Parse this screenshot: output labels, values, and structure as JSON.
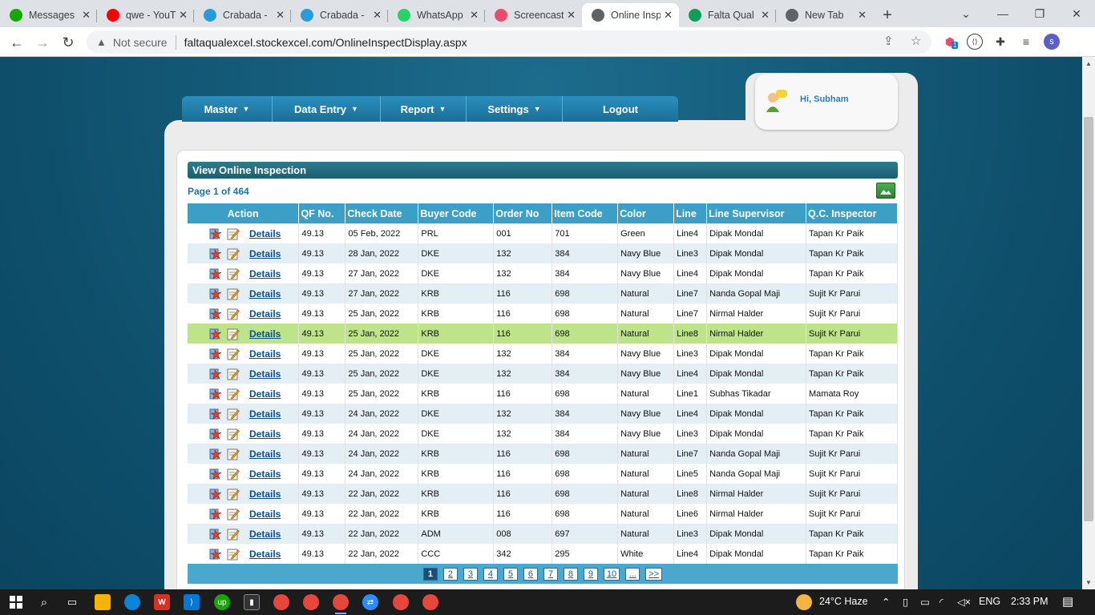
{
  "browser": {
    "tabs": [
      {
        "title": "Messages",
        "icon": "upwork-icon",
        "color": "#14a800"
      },
      {
        "title": "qwe - YouT",
        "icon": "youtube-icon",
        "color": "#ff0000"
      },
      {
        "title": "Crabada -",
        "icon": "crabada-icon",
        "color": "#2a9bd6"
      },
      {
        "title": "Crabada -",
        "icon": "crabada-icon",
        "color": "#2a9bd6"
      },
      {
        "title": "WhatsApp",
        "icon": "whatsapp-icon",
        "color": "#25d366"
      },
      {
        "title": "Screencast",
        "icon": "screencast-icon",
        "color": "#e94c6f"
      },
      {
        "title": "Online Insp",
        "icon": "globe-icon",
        "color": "#5f6368"
      },
      {
        "title": "Falta Qual",
        "icon": "sheets-icon",
        "color": "#0f9d58"
      },
      {
        "title": "New Tab",
        "icon": "chrome-icon",
        "color": "#5f6368"
      }
    ],
    "security": "Not secure",
    "url": "faltaqualexcel.stockexcel.com/OnlineInspectDisplay.aspx",
    "profile_initial": "s",
    "ext_badge": "1"
  },
  "menu": [
    {
      "label": "Master",
      "caret": "▼"
    },
    {
      "label": "Data Entry",
      "caret": "▼"
    },
    {
      "label": "Report",
      "caret": "▼"
    },
    {
      "label": "Settings",
      "caret": "▼"
    },
    {
      "label": "Logout",
      "caret": ""
    }
  ],
  "user": {
    "greeting": "Hi, Subham"
  },
  "panel": {
    "title": "View Online Inspection",
    "page_info": "Page 1 of 464"
  },
  "table": {
    "headers": [
      "Action",
      "QF No.",
      "Check Date",
      "Buyer Code",
      "Order No",
      "Item Code",
      "Color",
      "Line",
      "Line Supervisor",
      "Q.C. Inspector"
    ],
    "details_label": "Details",
    "selected_row": 5,
    "rows": [
      [
        "49.13",
        "05 Feb, 2022",
        "PRL",
        "001",
        "701",
        "Green",
        "Line4",
        "Dipak Mondal",
        "Tapan Kr Paik"
      ],
      [
        "49.13",
        "28 Jan, 2022",
        "DKE",
        "132",
        "384",
        "Navy Blue",
        "Line3",
        "Dipak Mondal",
        "Tapan Kr Paik"
      ],
      [
        "49.13",
        "27 Jan, 2022",
        "DKE",
        "132",
        "384",
        "Navy Blue",
        "Line4",
        "Dipak Mondal",
        "Tapan Kr Paik"
      ],
      [
        "49.13",
        "27 Jan, 2022",
        "KRB",
        "116",
        "698",
        "Natural",
        "Line7",
        "Nanda Gopal Maji",
        "Sujit Kr Parui"
      ],
      [
        "49.13",
        "25 Jan, 2022",
        "KRB",
        "116",
        "698",
        "Natural",
        "Line7",
        "Nirmal Halder",
        "Sujit Kr Parui"
      ],
      [
        "49.13",
        "25 Jan, 2022",
        "KRB",
        "116",
        "698",
        "Natural",
        "Line8",
        "Nirmal Halder",
        "Sujit Kr Parui"
      ],
      [
        "49.13",
        "25 Jan, 2022",
        "DKE",
        "132",
        "384",
        "Navy Blue",
        "Line3",
        "Dipak Mondal",
        "Tapan Kr Paik"
      ],
      [
        "49.13",
        "25 Jan, 2022",
        "DKE",
        "132",
        "384",
        "Navy Blue",
        "Line4",
        "Dipak Mondal",
        "Tapan Kr Paik"
      ],
      [
        "49.13",
        "25 Jan, 2022",
        "KRB",
        "116",
        "698",
        "Natural",
        "Line1",
        "Subhas Tikadar",
        "Mamata Roy"
      ],
      [
        "49.13",
        "24 Jan, 2022",
        "DKE",
        "132",
        "384",
        "Navy Blue",
        "Line4",
        "Dipak Mondal",
        "Tapan Kr Paik"
      ],
      [
        "49.13",
        "24 Jan, 2022",
        "DKE",
        "132",
        "384",
        "Navy Blue",
        "Line3",
        "Dipak Mondal",
        "Tapan Kr Paik"
      ],
      [
        "49.13",
        "24 Jan, 2022",
        "KRB",
        "116",
        "698",
        "Natural",
        "Line7",
        "Nanda Gopal Maji",
        "Sujit Kr Parui"
      ],
      [
        "49.13",
        "24 Jan, 2022",
        "KRB",
        "116",
        "698",
        "Natural",
        "Line5",
        "Nanda Gopal Maji",
        "Sujit Kr Parui"
      ],
      [
        "49.13",
        "22 Jan, 2022",
        "KRB",
        "116",
        "698",
        "Natural",
        "Line8",
        "Nirmal Halder",
        "Sujit Kr Parui"
      ],
      [
        "49.13",
        "22 Jan, 2022",
        "KRB",
        "116",
        "698",
        "Natural",
        "Line6",
        "Nirmal Halder",
        "Sujit Kr Parui"
      ],
      [
        "49.13",
        "22 Jan, 2022",
        "ADM",
        "008",
        "697",
        "Natural",
        "Line3",
        "Dipak Mondal",
        "Tapan Kr Paik"
      ],
      [
        "49.13",
        "22 Jan, 2022",
        "CCC",
        "342",
        "295",
        "White",
        "Line4",
        "Dipak Mondal",
        "Tapan Kr Paik"
      ]
    ]
  },
  "pager": {
    "current": "1",
    "pages": [
      "1",
      "2",
      "3",
      "4",
      "5",
      "6",
      "7",
      "8",
      "9",
      "10",
      "...",
      ">>"
    ]
  },
  "taskbar": {
    "weather": "24°C  Haze",
    "language": "ENG",
    "time": "2:33 PM"
  },
  "colors": {
    "header_bg": "#3b9fc6",
    "selected_row": "#bde48a",
    "alt_row": "#e4eef5",
    "title_bar": "#1b5f74"
  }
}
